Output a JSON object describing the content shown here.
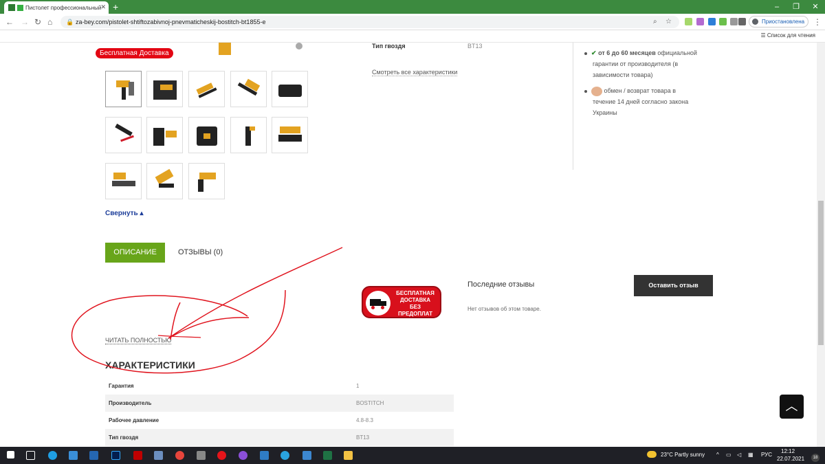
{
  "browser": {
    "tab_title": "Пистолет профессиональный",
    "new_tab": "+",
    "url": "za-bey.com/pistolet-shtiftozabivnoj-pnevmaticheskij-bostitch-bt1855-e",
    "profile": "Приостановлена",
    "reading_list": "Список для чтения",
    "win_controls": [
      "–",
      "❐",
      "✕"
    ]
  },
  "product": {
    "promo_badge": "Бесплатная Доставка",
    "collapse_link": "Свернуть ▴",
    "spec_preview_key": "Тип гвоздя",
    "spec_preview_value": "BT13",
    "all_specs_link": "Смотреть все характеристики",
    "guarantee": {
      "item1_bold": "от 6 до 60 месяцев",
      "item1_line1": "официальной",
      "item1_line2": "гарантии от производителя (в",
      "item1_line3": "зависимости товара)",
      "item2_line1": "обмен / возврат товара в",
      "item2_line2": "течение 14 дней согласно закона",
      "item2_line3": "Украины"
    }
  },
  "tabs": {
    "description": "ОПИСАНИЕ",
    "reviews": "ОТЗЫВЫ (0)"
  },
  "delivery_badge": {
    "line1": "БЕСПЛАТНАЯ",
    "line2": "ДОСТАВКА",
    "line3": "БЕЗ",
    "line4": "ПРЕДОПЛАТ"
  },
  "description": {
    "read_more": "ЧИТАТЬ ПОЛНОСТЬЮ"
  },
  "specs": {
    "heading": "ХАРАКТЕРИСТИКИ",
    "rows": [
      {
        "key": "Гарантия",
        "value": "1"
      },
      {
        "key": "Производитель",
        "value": "BOSTITCH"
      },
      {
        "key": "Рабочее давление",
        "value": "4.8-8.3"
      },
      {
        "key": "Тип гвоздя",
        "value": "BT13"
      }
    ]
  },
  "reviews": {
    "title": "Последние отзывы",
    "button": "Оставить отзыв",
    "empty": "Нет отзывов об этом товаре."
  },
  "taskbar": {
    "weather": "23°C  Partly sunny",
    "lang": "РУС",
    "time": "12:12",
    "date": "22.07.2021",
    "badge_count": "18"
  }
}
